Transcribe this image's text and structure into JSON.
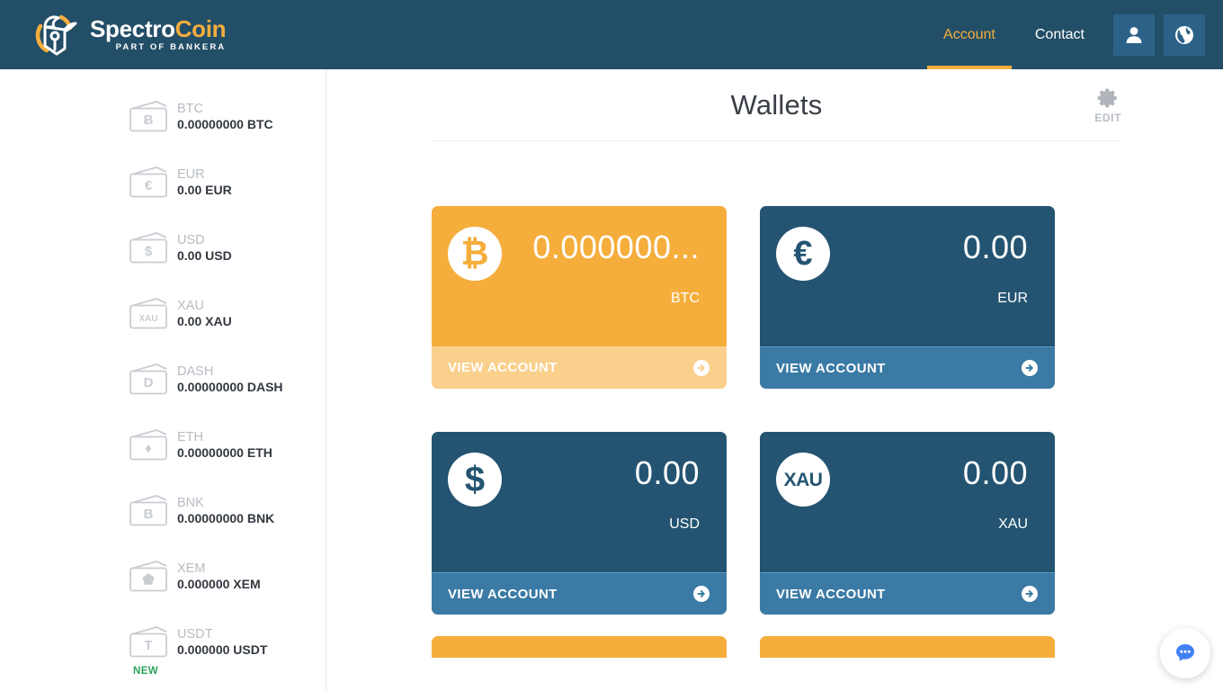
{
  "header": {
    "logo": {
      "name_part1": "Spectro",
      "name_part2": "Coin",
      "subtitle": "PART OF BANKERA",
      "mark_icon": "spectrocoin-bull-logo-icon"
    },
    "nav": [
      {
        "label": "Account",
        "active": true
      },
      {
        "label": "Contact",
        "active": false
      }
    ],
    "buttons": [
      {
        "icon": "user-icon",
        "name": "user-account-button"
      },
      {
        "icon": "globe-icon",
        "name": "language-globe-button"
      }
    ],
    "accent_color": "#F5AE3C",
    "background_color": "#234E68"
  },
  "sidebar": {
    "wallets": [
      {
        "code": "BTC",
        "balance": "0.00000000 BTC",
        "symbol": "Ƀ",
        "badge": ""
      },
      {
        "code": "EUR",
        "balance": "0.00 EUR",
        "symbol": "€",
        "badge": ""
      },
      {
        "code": "USD",
        "balance": "0.00 USD",
        "symbol": "$",
        "badge": ""
      },
      {
        "code": "XAU",
        "balance": "0.00 XAU",
        "symbol": "XAU",
        "badge": ""
      },
      {
        "code": "DASH",
        "balance": "0.00000000 DASH",
        "symbol": "D",
        "badge": ""
      },
      {
        "code": "ETH",
        "balance": "0.00000000 ETH",
        "symbol": "♦",
        "badge": ""
      },
      {
        "code": "BNK",
        "balance": "0.00000000 BNK",
        "symbol": "B",
        "badge": ""
      },
      {
        "code": "XEM",
        "balance": "0.000000 XEM",
        "symbol": "⬟",
        "badge": ""
      },
      {
        "code": "USDT",
        "balance": "0.000000 USDT",
        "symbol": "T",
        "badge": "NEW"
      }
    ],
    "new_badge_color": "#2EA25B"
  },
  "main": {
    "title": "Wallets",
    "edit": {
      "label": "EDIT",
      "icon": "gear-icon"
    },
    "cards": [
      {
        "amount": "0.000000...",
        "currency": "BTC",
        "symbol": "₿",
        "theme": "orange",
        "action": "VIEW ACCOUNT"
      },
      {
        "amount": "0.00",
        "currency": "EUR",
        "symbol": "€",
        "theme": "blue",
        "action": "VIEW ACCOUNT"
      },
      {
        "amount": "0.00",
        "currency": "USD",
        "symbol": "$",
        "theme": "blue",
        "action": "VIEW ACCOUNT"
      },
      {
        "amount": "0.00",
        "currency": "XAU",
        "symbol": "XAU",
        "theme": "blue",
        "action": "VIEW ACCOUNT"
      }
    ],
    "card_colors": {
      "orange_body": "#F5AE3C",
      "orange_footer": "#FAD08C",
      "blue_body": "#245471",
      "blue_footer": "#3A7AA5"
    }
  },
  "chat": {
    "icon": "chat-bubble-icon",
    "color": "#4281F5"
  }
}
